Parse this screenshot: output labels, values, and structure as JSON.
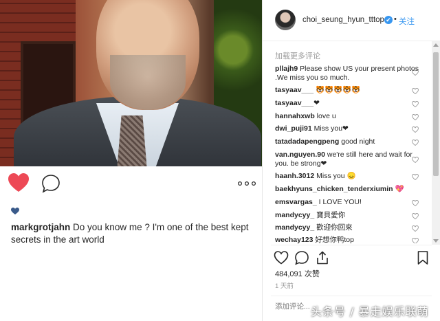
{
  "post": {
    "caption_user": "markgrotjahn",
    "caption_text": " Do you know me ? I'm one of the best kept secrets in the art world"
  },
  "header": {
    "username": "choi_seung_hyun_tttop",
    "verified_mark": "✔",
    "separator": "•",
    "follow_label": "关注"
  },
  "comments_panel": {
    "load_more_label": "加载更多评论",
    "comments": [
      {
        "user": "pllajh9",
        "text": " Please show US your present photos .We miss you so much."
      },
      {
        "user": "tasyaav___",
        "text": " 🐯🐯🐯🐯🐯"
      },
      {
        "user": "tasyaav___",
        "text": "❤"
      },
      {
        "user": "hannahxwb",
        "text": " love u"
      },
      {
        "user": "dwi_puji91",
        "text": " Miss you❤"
      },
      {
        "user": "tatadadapengpeng",
        "text": " good night"
      },
      {
        "user": "van.nguyen.90",
        "text": " we're still here and wait for you. be strong❤"
      },
      {
        "user": "haanh.3012",
        "text": " Miss you 😞"
      },
      {
        "user": "baekhyuns_chicken_tenderxiumin",
        "text": " 💖"
      },
      {
        "user": "emsvargas_",
        "text": " I LOVE YOU!"
      },
      {
        "user": "mandycyy_",
        "text": " 寶貝愛你"
      },
      {
        "user": "mandycyy_",
        "text": " 歡迎你回來"
      },
      {
        "user": "wechay123",
        "text": " 好想你鸭top"
      }
    ]
  },
  "footer": {
    "likes": "484,091 次赞",
    "timestamp": "1 天前",
    "add_comment_placeholder": "添加评论..."
  },
  "watermark": "头条号 / 暴走娱乐联萌",
  "colors": {
    "like_red": "#ed4956",
    "link_blue": "#3897f0",
    "verified_blue": "#3897f0",
    "muted_gray": "#999999"
  },
  "icons": [
    "heart-filled-icon",
    "comment-icon",
    "more-options-icon",
    "heart-outline-icon",
    "share-icon",
    "bookmark-icon",
    "verified-icon"
  ]
}
